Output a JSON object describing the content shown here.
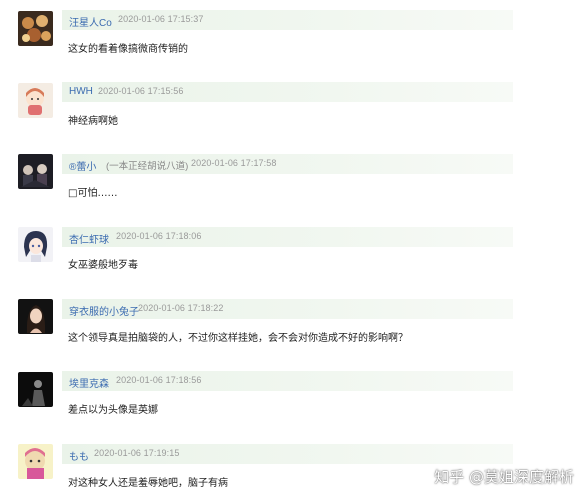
{
  "comments": [
    {
      "username": "汪星人Co",
      "timestamp": "2020-01-06 17:15:37",
      "text": "这女的看着像搞微商传销的"
    },
    {
      "username": "HWH",
      "timestamp": "2020-01-06 17:15:56",
      "text": "神经病啊她"
    },
    {
      "username": "®蕾小",
      "tag": "(一本正经胡说八道)",
      "timestamp": "2020-01-06 17:17:58",
      "text": "□可怕……"
    },
    {
      "username": "杏仁虾球",
      "timestamp": "2020-01-06 17:18:06",
      "text": "女巫婆般地歹毒"
    },
    {
      "username": "穿衣服的小兔子",
      "timestamp": "2020-01-06 17:18:22",
      "text": "这个领导真是拍脑袋的人，不过你这样挂她，会不会对你造成不好的影响啊？"
    },
    {
      "username": "埃里克森",
      "timestamp": "2020-01-06 17:18:56",
      "text": "差点以为头像是英娜"
    },
    {
      "username": "もも",
      "timestamp": "2020-01-06 17:19:15",
      "text": "对这种女人还是羞辱她吧，脑子有病"
    }
  ],
  "watermark": "知乎 @莫姐深度解析",
  "colors": {
    "username": "#3b6bb0",
    "timestamp": "#9a9a9a",
    "header_bg": "#eaf3e9"
  }
}
